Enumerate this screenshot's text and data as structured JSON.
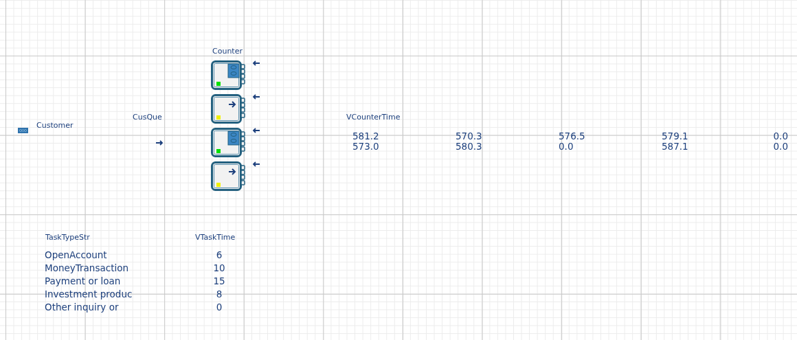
{
  "source": {
    "label": "Customer"
  },
  "queue": {
    "label": "CusQue"
  },
  "counter": {
    "label": "Counter",
    "machines": [
      {
        "busy": true,
        "color": "#00e000"
      },
      {
        "busy": false,
        "color": "#f0f000"
      },
      {
        "busy": true,
        "color": "#00e000"
      },
      {
        "busy": false,
        "color": "#f0f000"
      }
    ]
  },
  "counter_time": {
    "label": "VCounterTime",
    "rows": [
      [
        "581.2",
        "570.3",
        "576.5",
        "579.1",
        "0.0"
      ],
      [
        "573.0",
        "580.3",
        "0.0",
        "587.1",
        "0.0"
      ]
    ]
  },
  "task_types": {
    "label": "TaskTypeStr",
    "values": [
      "OpenAccount",
      "MoneyTransaction",
      "Payment or loan",
      "Investment produc",
      "Other inquiry or"
    ]
  },
  "task_times": {
    "label": "VTaskTime",
    "values": [
      "6",
      "10",
      "15",
      "8",
      "0"
    ]
  }
}
